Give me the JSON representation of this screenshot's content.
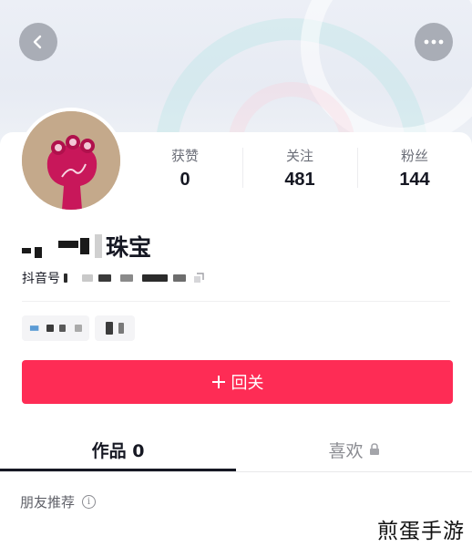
{
  "header": {
    "back_icon": "chevron-left-icon",
    "more_icon": "more-horizontal-icon"
  },
  "profile": {
    "stats": [
      {
        "label": "获赞",
        "value": "0"
      },
      {
        "label": "关注",
        "value": "481"
      },
      {
        "label": "粉丝",
        "value": "144"
      }
    ],
    "nickname_visible": "珠宝",
    "id_label": "抖音号",
    "follow_button_label": "回关",
    "follow_icon": "plus-icon"
  },
  "tabs": [
    {
      "label": "作品 0"
    },
    {
      "label": "喜欢"
    }
  ],
  "likes_lock_icon": "lock-icon",
  "recommend": {
    "label": "朋友推荐",
    "info_icon": "info-icon"
  },
  "watermark": "煎蛋手游",
  "colors": {
    "accent": "#fe2c55",
    "text": "#161823",
    "muted": "#8a8b91"
  }
}
